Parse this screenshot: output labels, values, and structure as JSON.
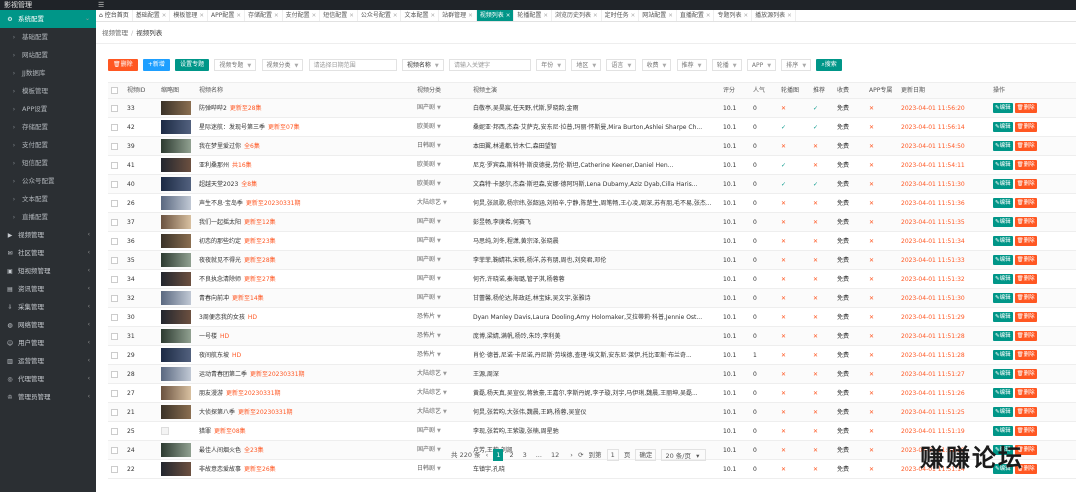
{
  "app": {
    "title": "影视管理",
    "collapse_icon": "menu-fold-icon"
  },
  "sidebar": {
    "items": [
      {
        "label": "系统配置",
        "icon": "gear-icon",
        "active": true,
        "expanded": true,
        "sub": false
      },
      {
        "label": "基础配置",
        "sub": true
      },
      {
        "label": "网站配置",
        "sub": true
      },
      {
        "label": "JJ数据库",
        "sub": true
      },
      {
        "label": "模板管理",
        "sub": true
      },
      {
        "label": "APP设置",
        "sub": true
      },
      {
        "label": "存储配置",
        "sub": true
      },
      {
        "label": "支付配置",
        "sub": true
      },
      {
        "label": "短信配置",
        "sub": true
      },
      {
        "label": "公众号配置",
        "sub": true
      },
      {
        "label": "文本配置",
        "sub": true
      },
      {
        "label": "直播配置",
        "sub": true
      },
      {
        "label": "视频管理",
        "icon": "play-icon",
        "sub": false
      },
      {
        "label": "社区管理",
        "icon": "chat-icon",
        "sub": false
      },
      {
        "label": "短视频管理",
        "icon": "film-icon",
        "sub": false
      },
      {
        "label": "资讯管理",
        "icon": "document-icon",
        "sub": false
      },
      {
        "label": "采集管理",
        "icon": "download-icon",
        "sub": false
      },
      {
        "label": "网络管理",
        "icon": "globe-icon",
        "sub": false
      },
      {
        "label": "用户管理",
        "icon": "user-icon",
        "sub": false
      },
      {
        "label": "运营管理",
        "icon": "chart-icon",
        "sub": false
      },
      {
        "label": "代理管理",
        "icon": "agent-icon",
        "sub": false
      },
      {
        "label": "管理员管理",
        "icon": "admin-icon",
        "sub": false
      }
    ]
  },
  "tabs": [
    {
      "label": "控台首页",
      "home": true
    },
    {
      "label": "基础配置"
    },
    {
      "label": "模板管理"
    },
    {
      "label": "APP配置"
    },
    {
      "label": "存储配置"
    },
    {
      "label": "支付配置"
    },
    {
      "label": "短信配置"
    },
    {
      "label": "公众号配置"
    },
    {
      "label": "文本配置"
    },
    {
      "label": "站群管理"
    },
    {
      "label": "视频列表",
      "active": true
    },
    {
      "label": "轮播配置"
    },
    {
      "label": "浏览历史列表"
    },
    {
      "label": "定时任务"
    },
    {
      "label": "网站配置"
    },
    {
      "label": "直播配置"
    },
    {
      "label": "专题列表"
    },
    {
      "label": "播放源列表"
    }
  ],
  "breadcrumb": {
    "parent": "视频管理",
    "current": "视频列表"
  },
  "toolbar": {
    "delete_label": "删除",
    "add_label": "新增",
    "topic_label": "设置专题",
    "filters": {
      "topic": "视频专题",
      "category": "视频分类",
      "date_placeholder": "请选择日期范围",
      "field": "视频名称",
      "keyword_placeholder": "请输入关键字",
      "year": "年份",
      "region": "地区",
      "language": "语言",
      "charge": "收费",
      "recommend": "推荐",
      "carousel": "轮播",
      "app": "APP",
      "sort": "排序"
    },
    "search_label": "搜索"
  },
  "table": {
    "headers": [
      "",
      "视频ID",
      "缩略图",
      "视频名称",
      "视频分类",
      "视频主演",
      "评分",
      "人气",
      "轮播图",
      "推荐",
      "收费",
      "APP专属",
      "更新日期",
      "操作"
    ],
    "edit_label": "编辑",
    "delete_label": "删除",
    "rows": [
      {
        "id": "33",
        "name": "防弹哔哔2",
        "update": "更新至28集",
        "cat": "国产剧",
        "cast": "白敬亭,吴昊宸,任天野,代斯,罗晓韵,金雨",
        "score": "10.1",
        "pop": "0",
        "carousel": false,
        "rec": true,
        "charge": "免费",
        "app": false,
        "date": "2023-04-01 11:56:20",
        "thumb": "t0"
      },
      {
        "id": "42",
        "name": "星际迷航：发现号第三季",
        "update": "更新至07集",
        "cat": "欧美剧",
        "cast": "桑妮亚·邦西,杰森·艾萨克,安东尼·拉普,玛丽·怀斯曼,Mira Burton,Ashlei Sharpe Ch...",
        "score": "10.1",
        "pop": "0",
        "carousel": true,
        "rec": true,
        "charge": "免费",
        "app": false,
        "date": "2023-04-01 11:56:14",
        "thumb": "t1"
      },
      {
        "id": "39",
        "name": "我在梦里爱过你",
        "update": "全6集",
        "cat": "日韩剧",
        "cast": "本田翼,林遣都,铃木仁,森田望智",
        "score": "10.1",
        "pop": "0",
        "carousel": false,
        "rec": false,
        "charge": "免费",
        "app": false,
        "date": "2023-04-01 11:54:50",
        "thumb": "t2"
      },
      {
        "id": "41",
        "name": "亚利桑那州",
        "update": "共16集",
        "cat": "欧美剧",
        "cast": "尼克·罗宾森,斯科特·斯皮德曼,劳伦·斯坦,Catherine Keener,Daniel Hen...",
        "score": "10.1",
        "pop": "0",
        "carousel": true,
        "rec": false,
        "charge": "免费",
        "app": false,
        "date": "2023-04-01 11:54:11",
        "thumb": "t3"
      },
      {
        "id": "40",
        "name": "超越天堂2023",
        "update": "全8集",
        "cat": "欧美剧",
        "cast": "文森特·卡瑟尔,杰森·斯坦森,安娜·德阿玛斯,Lena Dubamy,Aziz Dyab,Cilla Haris...",
        "score": "10.1",
        "pop": "0",
        "carousel": true,
        "rec": true,
        "charge": "免费",
        "app": false,
        "date": "2023-04-01 11:51:30",
        "thumb": "t1"
      },
      {
        "id": "26",
        "name": "声生不息·宝岛季",
        "update": "更新至20230331期",
        "cat": "大陆综艺",
        "cast": "何炅,张凯歌,杨宗纬,张韶涵,刘柏辛,宁静,陈楚生,周笔畅,王心凌,周深,苏有朋,毛不易,张杰...",
        "score": "10.1",
        "pop": "0",
        "carousel": false,
        "rec": false,
        "charge": "免费",
        "app": false,
        "date": "2023-04-01 11:51:36",
        "thumb": "t4"
      },
      {
        "id": "37",
        "name": "我们一起摇太阳",
        "update": "更新至12集",
        "cat": "国产剧",
        "cast": "彭昱畅,李庚希,何赛飞",
        "score": "10.1",
        "pop": "0",
        "carousel": false,
        "rec": false,
        "charge": "免费",
        "app": false,
        "date": "2023-04-01 11:51:35",
        "thumb": "t5"
      },
      {
        "id": "36",
        "name": "初恋的那些约定",
        "update": "更新至23集",
        "cat": "国产剧",
        "cast": "马思纯,刘冬,程潇,黄宗泽,张晓晨",
        "score": "10.1",
        "pop": "0",
        "carousel": false,
        "rec": false,
        "charge": "免费",
        "app": false,
        "date": "2023-04-01 11:51:34",
        "thumb": "t0"
      },
      {
        "id": "35",
        "name": "夜夜就见不得光",
        "update": "更新至28集",
        "cat": "国产剧",
        "cast": "李菲菲,鞠婧祎,宋轶,杨洋,苏有朋,周也,刘奕君,邓伦",
        "score": "10.1",
        "pop": "0",
        "carousel": false,
        "rec": false,
        "charge": "免费",
        "app": false,
        "date": "2023-04-01 11:51:33",
        "thumb": "t2"
      },
      {
        "id": "34",
        "name": "不良执念清除师",
        "update": "更新至27集",
        "cat": "国产剧",
        "cast": "何齐,许晓诺,秦海璐,管子淇,杨蓉蓉",
        "score": "10.1",
        "pop": "0",
        "carousel": false,
        "rec": false,
        "charge": "免费",
        "app": false,
        "date": "2023-04-01 11:51:32",
        "thumb": "t3"
      },
      {
        "id": "32",
        "name": "青春向前冲",
        "update": "更新至14集",
        "cat": "国产剧",
        "cast": "甘蕾馨,杨伦达,陈政廷,林宝妹,吴文宇,张雅诗",
        "score": "10.1",
        "pop": "0",
        "carousel": false,
        "rec": false,
        "charge": "免费",
        "app": false,
        "date": "2023-04-01 11:51:30",
        "thumb": "t4"
      },
      {
        "id": "30",
        "name": "3周便恋我的女孩",
        "update": "HD",
        "cat": "恐怖片",
        "cast": "Dyan Manley Davis,Laura Dooling,Amy Holomaker,艾拉蒂莉·科普,Jennie Ost...",
        "score": "10.1",
        "pop": "0",
        "carousel": false,
        "rec": false,
        "charge": "免费",
        "app": false,
        "date": "2023-04-01 11:51:29",
        "thumb": "t3"
      },
      {
        "id": "31",
        "name": "一号楼",
        "update": "HD",
        "cat": "恐怖片",
        "cast": "庞博,梁婧,满帆,杨玲,朱玲,李利美",
        "score": "10.1",
        "pop": "0",
        "carousel": false,
        "rec": false,
        "charge": "免费",
        "app": false,
        "date": "2023-04-01 11:51:28",
        "thumb": "t2"
      },
      {
        "id": "29",
        "name": "夜间航东坡",
        "update": "HD",
        "cat": "恐怖片",
        "cast": "肖伦·德普,尼诺·卡尼诺,丹尼斯·劳埃德,查理·埃文斯,安东尼·莱伊,托比亚斯·布兰奇...",
        "score": "10.1",
        "pop": "1",
        "carousel": false,
        "rec": false,
        "charge": "免费",
        "app": false,
        "date": "2023-04-01 11:51:28",
        "thumb": "t1"
      },
      {
        "id": "28",
        "name": "运动青春团第二季",
        "update": "更新至20230331期",
        "cat": "大陆综艺",
        "cast": "王源,周深",
        "score": "10.1",
        "pop": "0",
        "carousel": false,
        "rec": false,
        "charge": "免费",
        "app": false,
        "date": "2023-04-01 11:51:27",
        "thumb": "t4"
      },
      {
        "id": "27",
        "name": "朋友漫游",
        "update": "更新至20230331期",
        "cat": "大陆综艺",
        "cast": "黄磊,杨天真,吴宣仪,蒋敦豪,王嘉尔,李斯丹妮,李子璇,刘宇,马伊琍,魏晨,王丽坤,吴磊...",
        "score": "10.1",
        "pop": "0",
        "carousel": false,
        "rec": false,
        "charge": "免费",
        "app": false,
        "date": "2023-04-01 11:51:26",
        "thumb": "t5"
      },
      {
        "id": "21",
        "name": "大侦探第八季",
        "update": "更新至20230331期",
        "cat": "大陆综艺",
        "cast": "何炅,张若昀,大张伟,魏晨,王鸥,杨蓉,吴宣仪",
        "score": "10.1",
        "pop": "0",
        "carousel": false,
        "rec": false,
        "charge": "免费",
        "app": false,
        "date": "2023-04-01 11:51:25",
        "thumb": "t0"
      },
      {
        "id": "25",
        "name": "猎罪",
        "update": "更新至08集",
        "cat": "国产剧",
        "cast": "李现,张若昀,王紫璇,张楠,周星驰",
        "score": "10.1",
        "pop": "0",
        "carousel": false,
        "rec": false,
        "charge": "免费",
        "app": false,
        "date": "2023-04-01 11:51:19",
        "thumb": "broken"
      },
      {
        "id": "24",
        "name": "最佳人间烟火色",
        "update": "全23集",
        "cat": "国产剧",
        "cast": "卢芳,王莉,刘凯",
        "score": "10.1",
        "pop": "0",
        "carousel": false,
        "rec": false,
        "charge": "免费",
        "app": false,
        "date": "2023-04-01 11:51:18",
        "thumb": "t2"
      },
      {
        "id": "22",
        "name": "非故意恋爱故事",
        "update": "更新至26集",
        "cat": "日韩剧",
        "cast": "车镇宇,孔晓",
        "score": "10.1",
        "pop": "0",
        "carousel": false,
        "rec": false,
        "charge": "免费",
        "app": false,
        "date": "2023-04-01 11:51:14",
        "thumb": "t3"
      }
    ]
  },
  "pagination": {
    "total": "共 220 条",
    "pages": [
      "1",
      "2",
      "3",
      "...",
      "12"
    ],
    "current": "1",
    "goto_label": "到第",
    "goto_value": "1",
    "page_suffix": "页",
    "confirm_label": "确定",
    "per_page": "20 条/页"
  },
  "watermark": "赚赚论坛",
  "colors": {
    "accent": "#009688",
    "danger": "#ff5722",
    "primary": "#1e9fff",
    "sidebar": "#2b2f33"
  }
}
